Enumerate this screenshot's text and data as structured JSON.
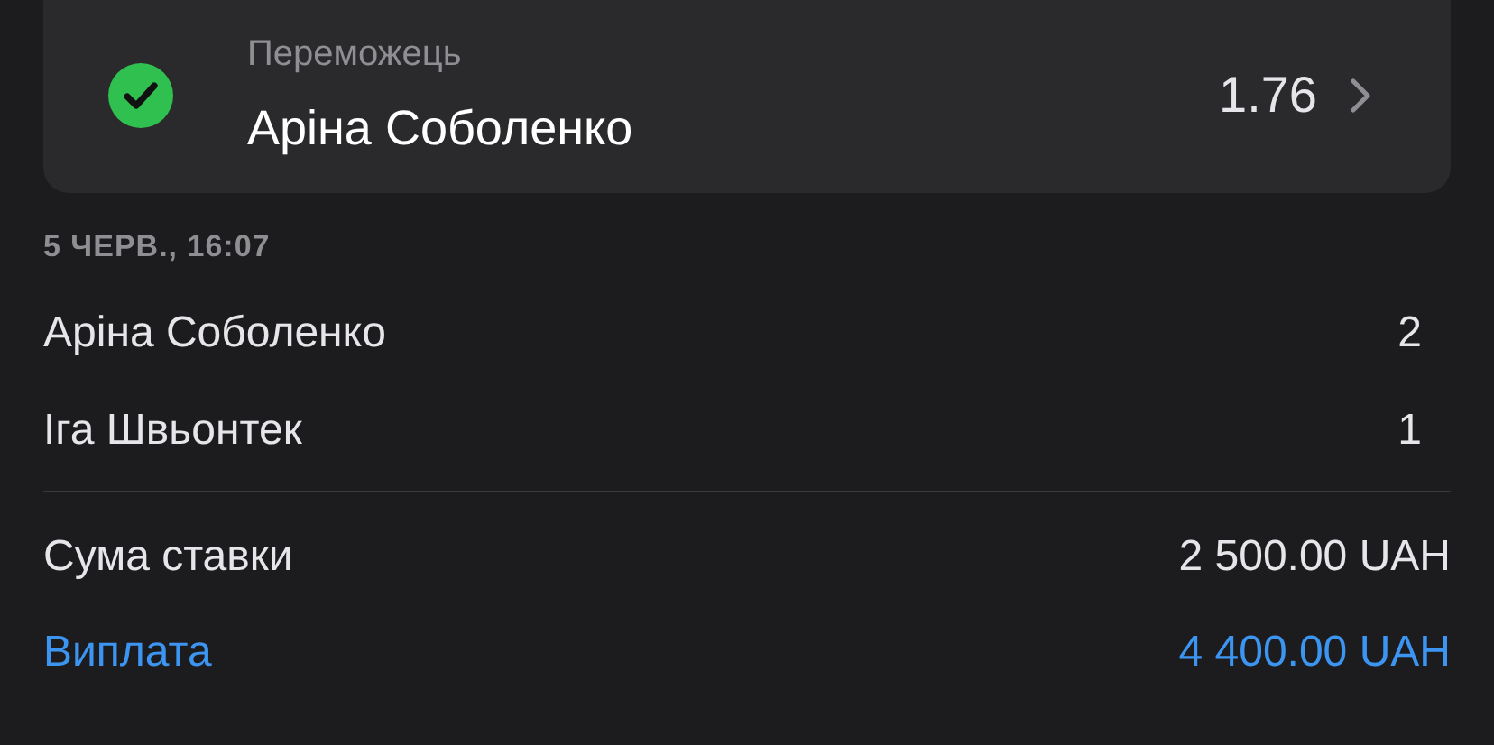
{
  "selection": {
    "market": "Переможець",
    "pick": "Аріна Соболенко",
    "odds": "1.76",
    "won": true
  },
  "timestamp": "5 ЧЕРВ., 16:07",
  "scores": [
    {
      "player": "Аріна Соболенко",
      "score": "2"
    },
    {
      "player": "Іга Швьонтек",
      "score": "1"
    }
  ],
  "summary": [
    {
      "label": "Сума ставки",
      "value": "2 500.00 UAH",
      "kind": "stake"
    },
    {
      "label": "Виплата",
      "value": "4 400.00 UAH",
      "kind": "payout"
    }
  ]
}
